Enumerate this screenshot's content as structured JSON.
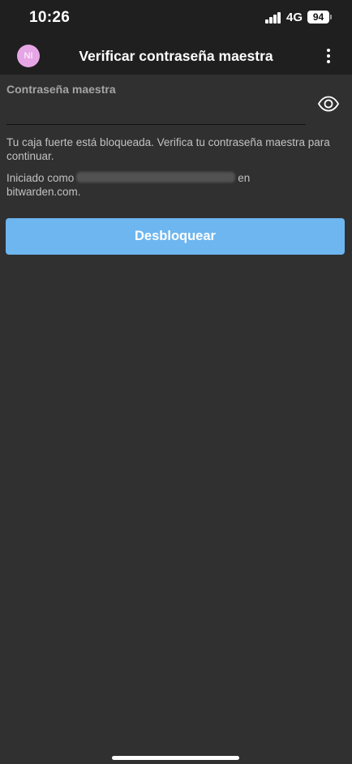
{
  "status_bar": {
    "time": "10:26",
    "network": "4G",
    "battery": "94"
  },
  "header": {
    "avatar_initials": "NI",
    "avatar_color": "#e6a6e6",
    "title": "Verificar contraseña maestra",
    "more_icon": "more-vertical-icon"
  },
  "form": {
    "password_label": "Contraseña maestra",
    "password_value": "",
    "toggle_icon": "eye-icon",
    "locked_message": "Tu caja fuerte está bloqueada. Verifica tu contraseña maestra para continuar.",
    "logged_in_prefix": "Iniciado como",
    "logged_in_suffix": "en",
    "server": "bitwarden.com.",
    "unlock_label": "Desbloquear",
    "accent_color": "#6db6f0"
  }
}
